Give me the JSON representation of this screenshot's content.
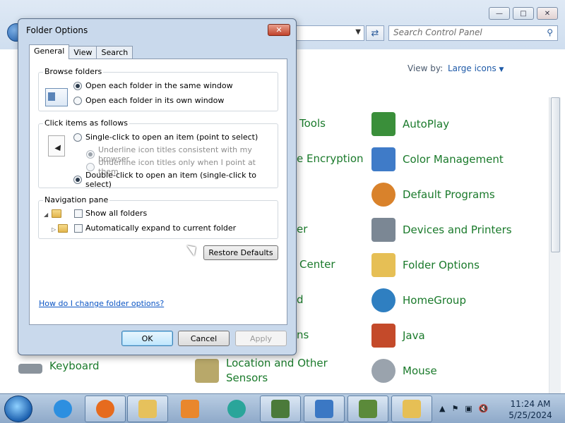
{
  "control_panel": {
    "search_placeholder": "Search Control Panel",
    "view_by_label": "View by:",
    "view_by_value": "Large icons",
    "items_right": [
      {
        "label": "AutoPlay",
        "icon": "autoplay-icon",
        "color": "#3a8f3a"
      },
      {
        "label": "Color Management",
        "icon": "color-management-icon",
        "color": "#3f7bc8"
      },
      {
        "label": "Default Programs",
        "icon": "default-programs-icon",
        "color": "#d9822b"
      },
      {
        "label": "Devices and Printers",
        "icon": "devices-printers-icon",
        "color": "#7b8794"
      },
      {
        "label": "Folder Options",
        "icon": "folder-options-icon",
        "color": "#e6bf55"
      },
      {
        "label": "HomeGroup",
        "icon": "homegroup-icon",
        "color": "#2f7fc1"
      },
      {
        "label": "Java",
        "icon": "java-icon",
        "color": "#c44a2a"
      },
      {
        "label": "Mouse",
        "icon": "mouse-icon",
        "color": "#9aa3ad"
      }
    ],
    "partial_labels": [
      "Tools",
      "e Encryption",
      "er",
      "Center",
      "d",
      "ns"
    ],
    "bottom_left_items": [
      {
        "label": "Keyboard",
        "icon": "keyboard-icon"
      },
      {
        "label": "Location and Other Sensors",
        "icon": "location-sensors-icon"
      }
    ],
    "link_color": "#1a7a2b"
  },
  "dialog": {
    "title": "Folder Options",
    "tabs": [
      "General",
      "View",
      "Search"
    ],
    "active_tab": "General",
    "browse": {
      "title": "Browse folders",
      "options": [
        "Open each folder in the same window",
        "Open each folder in its own window"
      ],
      "selected": 0
    },
    "click": {
      "title": "Click items as follows",
      "single": "Single-click to open an item (point to select)",
      "underline_always": "Underline icon titles consistent with my browser",
      "underline_point": "Underline icon titles only when I point at them",
      "double": "Double-click to open an item (single-click to select)"
    },
    "nav": {
      "title": "Navigation pane",
      "show_all": "Show all folders",
      "auto_expand": "Automatically expand to current folder"
    },
    "restore_defaults": "Restore Defaults",
    "help_link": "How do I change folder options?",
    "ok": "OK",
    "cancel": "Cancel",
    "apply": "Apply"
  },
  "taskbar": {
    "apps": [
      {
        "name": "internet-explorer",
        "color": "#2d8fe0"
      },
      {
        "name": "firefox",
        "color": "#e66b1e"
      },
      {
        "name": "windows-explorer",
        "color": "#e6c15c"
      },
      {
        "name": "media-player",
        "color": "#e9872c"
      },
      {
        "name": "edge",
        "color": "#2aa59a"
      },
      {
        "name": "document-app",
        "color": "#4b7a3a"
      },
      {
        "name": "control-panel",
        "color": "#3b78c4"
      },
      {
        "name": "minecraft",
        "color": "#5b8a3a"
      },
      {
        "name": "folder-options",
        "color": "#e6bf55"
      }
    ],
    "time": "11:24 AM",
    "date": "5/25/2024"
  }
}
